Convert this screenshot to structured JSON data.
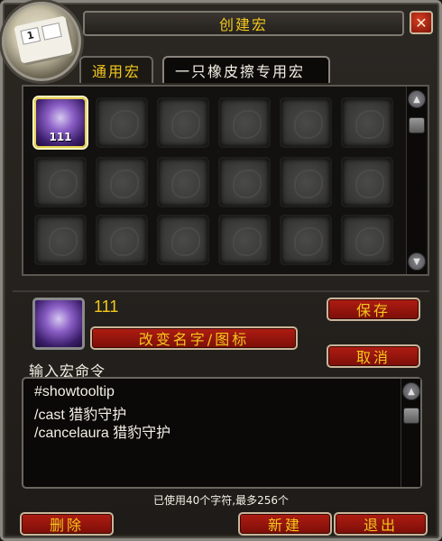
{
  "title": "创建宏",
  "close_glyph": "✕",
  "portrait_keys": [
    "1",
    ""
  ],
  "tabs": [
    {
      "label": "通用宏"
    },
    {
      "label": "一只橡皮擦专用宏"
    }
  ],
  "grid": {
    "filled_label": "111"
  },
  "selected": {
    "name": "111"
  },
  "buttons": {
    "change_name_icon": "改变名字/图标",
    "save": "保存",
    "cancel": "取消",
    "delete": "删除",
    "new": "新建",
    "exit": "退出"
  },
  "enter_command_label": "输入宏命令",
  "macro_lines": [
    "#showtooltip",
    "/cast 猎豹守护",
    "/cancelaura 猎豹守护"
  ],
  "char_count_text": "已使用40个字符,最多256个",
  "colors": {
    "gold": "#f2c81c",
    "button_red": "#b01d12"
  }
}
